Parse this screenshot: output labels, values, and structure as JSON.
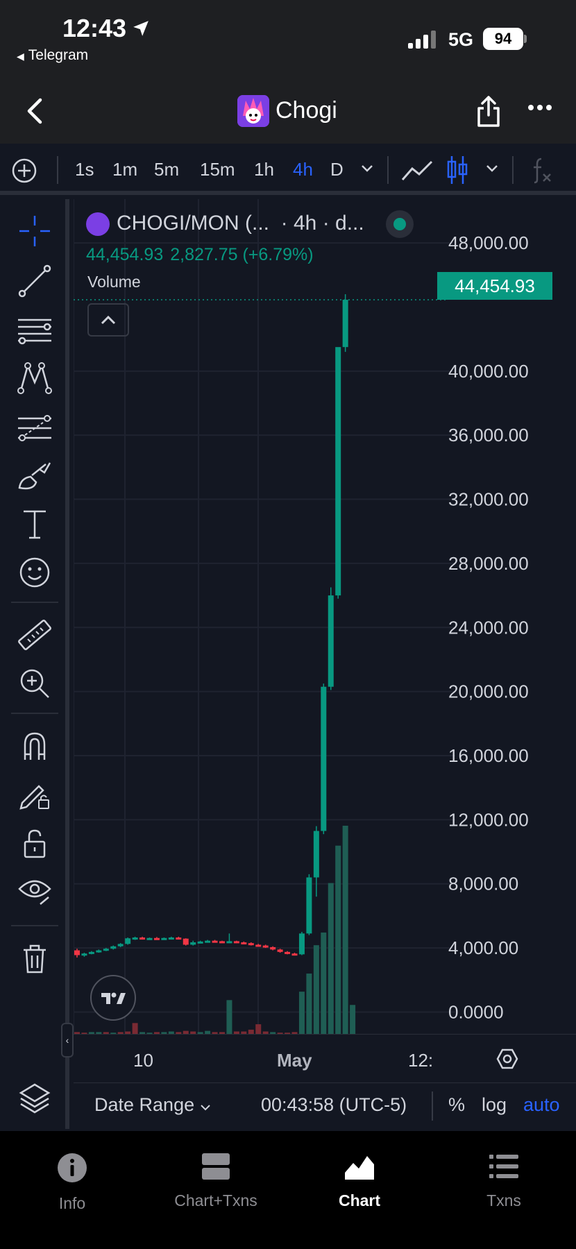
{
  "status": {
    "time": "12:43",
    "back_app": "Telegram",
    "network": "5G",
    "battery": "94"
  },
  "header": {
    "title": "Chogi"
  },
  "toolbar": {
    "intervals": [
      "1s",
      "1m",
      "5m",
      "15m",
      "1h",
      "4h",
      "D"
    ],
    "active_interval": "4h"
  },
  "chart": {
    "symbol": "CHOGI/MON (...",
    "interval_desc": "· 4h · d...",
    "last_price": "44,454.93",
    "change": "2,827.75 (+6.79%)",
    "volume_label": "Volume",
    "price_tag": "44,454.93"
  },
  "bottombar": {
    "date_range": "Date Range",
    "clock": "00:43:58 (UTC-5)",
    "pct": "%",
    "log": "log",
    "auto": "auto"
  },
  "tabs": [
    {
      "label": "Info",
      "icon": "info-icon"
    },
    {
      "label": "Chart+Txns",
      "icon": "split-icon"
    },
    {
      "label": "Chart",
      "icon": "chart-icon",
      "active": true
    },
    {
      "label": "Txns",
      "icon": "list-icon"
    }
  ],
  "colors": {
    "up": "#089981",
    "down": "#f23645",
    "accent": "#2962ff"
  },
  "chart_data": {
    "type": "candlestick",
    "y_ticks": [
      "48,000.00",
      "40,000.00",
      "36,000.00",
      "32,000.00",
      "28,000.00",
      "24,000.00",
      "20,000.00",
      "16,000.00",
      "12,000.00",
      "8,000.00",
      "4,000.00",
      "0.0000"
    ],
    "y_tick_values": [
      48000,
      40000,
      36000,
      32000,
      28000,
      24000,
      20000,
      16000,
      12000,
      8000,
      4000,
      0
    ],
    "x_ticks": [
      "10",
      "May",
      "12:"
    ],
    "ylim": [
      -500,
      49000
    ],
    "scale": "auto",
    "candles": [
      {
        "o": 3850,
        "h": 3950,
        "l": 3400,
        "c": 3550
      },
      {
        "o": 3550,
        "h": 3700,
        "l": 3450,
        "c": 3650
      },
      {
        "o": 3650,
        "h": 3800,
        "l": 3600,
        "c": 3750
      },
      {
        "o": 3750,
        "h": 3900,
        "l": 3700,
        "c": 3850
      },
      {
        "o": 3850,
        "h": 4000,
        "l": 3800,
        "c": 3950
      },
      {
        "o": 3950,
        "h": 4150,
        "l": 3900,
        "c": 4100
      },
      {
        "o": 4100,
        "h": 4300,
        "l": 4050,
        "c": 4250
      },
      {
        "o": 4250,
        "h": 4650,
        "l": 4200,
        "c": 4600
      },
      {
        "o": 4600,
        "h": 4700,
        "l": 4500,
        "c": 4650
      },
      {
        "o": 4650,
        "h": 4700,
        "l": 4550,
        "c": 4600
      },
      {
        "o": 4600,
        "h": 4650,
        "l": 4550,
        "c": 4620
      },
      {
        "o": 4620,
        "h": 4680,
        "l": 4580,
        "c": 4600
      },
      {
        "o": 4600,
        "h": 4650,
        "l": 4570,
        "c": 4620
      },
      {
        "o": 4620,
        "h": 4700,
        "l": 4600,
        "c": 4650
      },
      {
        "o": 4650,
        "h": 4700,
        "l": 4550,
        "c": 4580
      },
      {
        "o": 4580,
        "h": 4600,
        "l": 4150,
        "c": 4200
      },
      {
        "o": 4200,
        "h": 4450,
        "l": 4150,
        "c": 4350
      },
      {
        "o": 4350,
        "h": 4450,
        "l": 4300,
        "c": 4400
      },
      {
        "o": 4400,
        "h": 4500,
        "l": 4350,
        "c": 4450
      },
      {
        "o": 4450,
        "h": 4500,
        "l": 4380,
        "c": 4420
      },
      {
        "o": 4420,
        "h": 4450,
        "l": 4350,
        "c": 4380
      },
      {
        "o": 4380,
        "h": 4900,
        "l": 4350,
        "c": 4420
      },
      {
        "o": 4420,
        "h": 4450,
        "l": 4300,
        "c": 4350
      },
      {
        "o": 4350,
        "h": 4400,
        "l": 4250,
        "c": 4300
      },
      {
        "o": 4300,
        "h": 4350,
        "l": 4150,
        "c": 4200
      },
      {
        "o": 4200,
        "h": 4250,
        "l": 4100,
        "c": 4150
      },
      {
        "o": 4150,
        "h": 4200,
        "l": 4000,
        "c": 4050
      },
      {
        "o": 4050,
        "h": 4100,
        "l": 3850,
        "c": 3900
      },
      {
        "o": 3900,
        "h": 3950,
        "l": 3700,
        "c": 3750
      },
      {
        "o": 3750,
        "h": 3800,
        "l": 3600,
        "c": 3650
      },
      {
        "o": 3650,
        "h": 3700,
        "l": 3550,
        "c": 3600
      },
      {
        "o": 3600,
        "h": 5000,
        "l": 3550,
        "c": 4900
      },
      {
        "o": 4900,
        "h": 8600,
        "l": 4800,
        "c": 8400
      },
      {
        "o": 8400,
        "h": 11600,
        "l": 7200,
        "c": 11300
      },
      {
        "o": 11300,
        "h": 20500,
        "l": 11100,
        "c": 20300
      },
      {
        "o": 20300,
        "h": 26500,
        "l": 20100,
        "c": 26000
      },
      {
        "o": 26000,
        "h": 31400,
        "l": 25800,
        "c": 41500
      },
      {
        "o": 41500,
        "h": 44800,
        "l": 41200,
        "c": 44454.93
      }
    ],
    "volume": [
      3,
      2,
      3,
      3,
      3,
      2,
      3,
      4,
      18,
      3,
      2,
      3,
      3,
      4,
      3,
      5,
      4,
      3,
      5,
      3,
      3,
      56,
      4,
      4,
      7,
      16,
      4,
      3,
      2,
      2,
      3,
      70,
      100,
      147,
      168,
      250,
      312,
      345,
      48
    ],
    "volume_colors": [
      "d",
      "d",
      "u",
      "u",
      "d",
      "u",
      "d",
      "d",
      "d",
      "u",
      "u",
      "d",
      "u",
      "u",
      "d",
      "d",
      "d",
      "u",
      "u",
      "d",
      "d",
      "u",
      "d",
      "d",
      "d",
      "d",
      "d",
      "u",
      "d",
      "d",
      "d",
      "u",
      "u",
      "u",
      "u",
      "u",
      "u",
      "u",
      "u"
    ]
  }
}
